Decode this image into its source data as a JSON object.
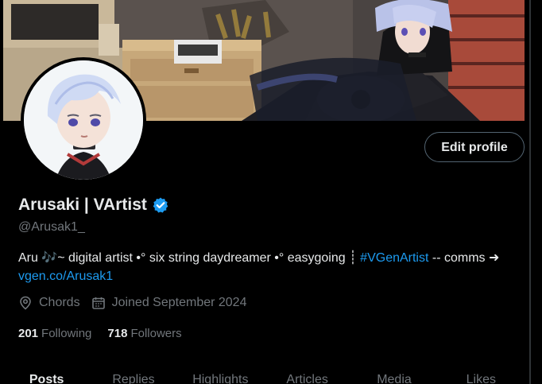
{
  "profile": {
    "display_name": "Arusaki | VArtist",
    "handle": "@Arusak1_",
    "edit_button": "Edit profile",
    "bio": {
      "part1": "Aru ",
      "emoji": "🎶",
      "part2": "~ digital artist •° six string daydreamer •° easygoing ┊ ",
      "hashtag": "#VGenArtist",
      "part3": " -- comms ➜ ",
      "link": "vgen.co/Arusak1"
    },
    "location": "Chords",
    "joined": "Joined September 2024",
    "following_count": "201",
    "following_label": "Following",
    "followers_count": "718",
    "followers_label": "Followers"
  },
  "tabs": [
    {
      "label": "Posts"
    },
    {
      "label": "Replies"
    },
    {
      "label": "Highlights"
    },
    {
      "label": "Articles"
    },
    {
      "label": "Media"
    },
    {
      "label": "Likes"
    }
  ],
  "icons": {
    "verified": "verified-badge-icon",
    "location": "location-pin-icon",
    "calendar": "calendar-icon"
  },
  "colors": {
    "accent": "#1d9bf0",
    "text": "#e7e9ea",
    "muted": "#71767b",
    "border": "#536471",
    "background": "#000000"
  }
}
